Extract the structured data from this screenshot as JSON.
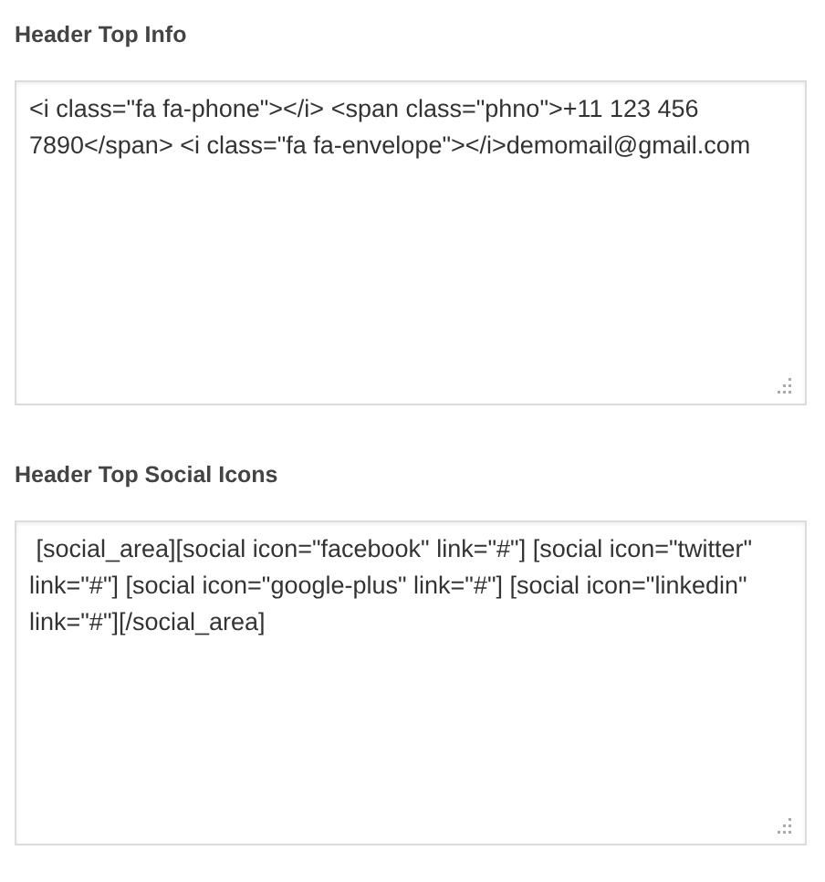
{
  "fields": [
    {
      "label": "Header Top Info",
      "value": "<i class=\"fa fa-phone\"></i> <span class=\"phno\">+11 123 456 7890</span> <i class=\"fa fa-envelope\"></i>demomail@gmail.com"
    },
    {
      "label": "Header Top Social Icons",
      "value": " [social_area][social icon=\"facebook\" link=\"#\"] [social icon=\"twitter\" link=\"#\"] [social icon=\"google-plus\" link=\"#\"] [social icon=\"linkedin\" link=\"#\"][/social_area]"
    }
  ]
}
